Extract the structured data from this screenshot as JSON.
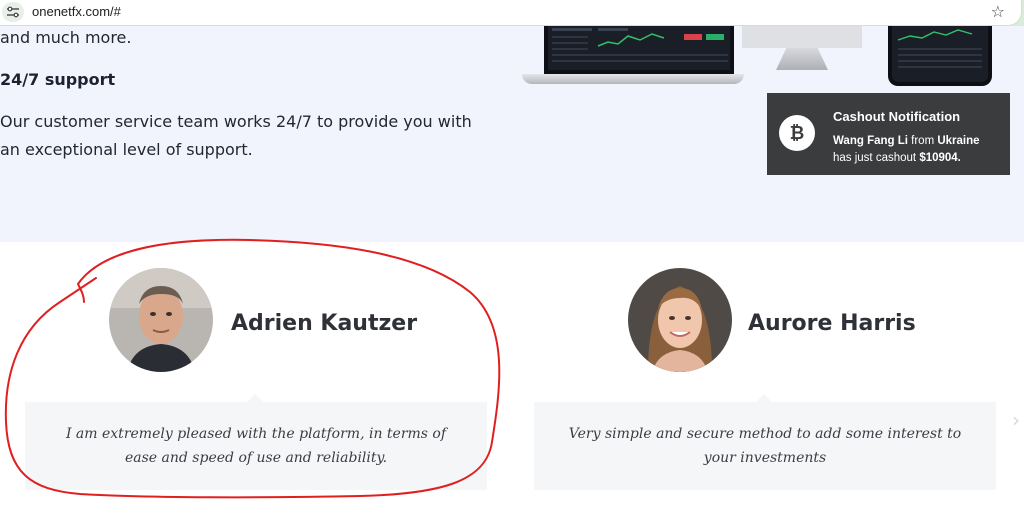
{
  "browser": {
    "url": "onenetfx.com/#",
    "site_info_icon": "tune-icon",
    "bookmark_icon": "star-icon"
  },
  "features": {
    "tail_text": "and much more.",
    "support_heading": "24/7 support",
    "support_body": "Our customer service team works 24/7 to provide you with an exceptional level of support."
  },
  "notification": {
    "icon": "bitcoin-icon",
    "title": "Cashout Notification",
    "name": "Wang Fang Li",
    "from_word": "from",
    "country": "Ukraine",
    "mid_text": "has just cashout",
    "amount": "$10904."
  },
  "testimonials": [
    {
      "name": "Adrien Kautzer",
      "quote": "I am extremely pleased with the platform, in terms of ease and speed of use and reliability."
    },
    {
      "name": "Aurore Harris",
      "quote": "Very simple and secure method to add some interest to your investments"
    }
  ],
  "colors": {
    "annotation": "#e02020",
    "features_bg": "#f1f3fd",
    "notification_bg": "#3b3c3e"
  }
}
